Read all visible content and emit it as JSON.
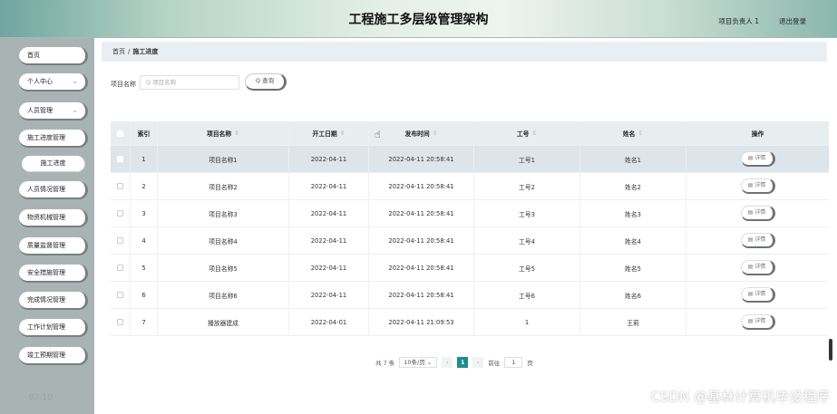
{
  "header": {
    "title": "工程施工多层级管理架构",
    "user": "项目负责人 1",
    "logout": "退出登录"
  },
  "sidebar": {
    "items": [
      {
        "label": "首页"
      },
      {
        "label": "个人中心",
        "chevron": "⌄"
      },
      {
        "label": "人员管理",
        "chevron": "⌄"
      },
      {
        "label": "施工进度管理"
      },
      {
        "label": "施工进度"
      },
      {
        "label": "人员情况管理"
      },
      {
        "label": "物资机械管理"
      },
      {
        "label": "质量监督管理"
      },
      {
        "label": "安全措施管理"
      },
      {
        "label": "完成情况管理"
      },
      {
        "label": "工作计划管理"
      },
      {
        "label": "竣工预期管理"
      }
    ],
    "time": "03:10"
  },
  "breadcrumb": {
    "home": "首页",
    "sep": "/",
    "current": "施工进度"
  },
  "search": {
    "label": "项目名称",
    "placeholder": "Q 项目名称",
    "button": "Q 查询"
  },
  "table": {
    "columns": [
      "索引",
      "项目名称",
      "开工日期",
      "发布时间",
      "工号",
      "姓名",
      "操作"
    ],
    "sort_icon": "⇕",
    "detail_label": "▤ 详情",
    "rows": [
      {
        "index": "1",
        "project": "项目名称1",
        "start": "2022-04-11",
        "publish": "2022-04-11 20:58:41",
        "job_no": "工号1",
        "name": "姓名1"
      },
      {
        "index": "2",
        "project": "项目名称2",
        "start": "2022-04-11",
        "publish": "2022-04-11 20:58:41",
        "job_no": "工号2",
        "name": "姓名2"
      },
      {
        "index": "3",
        "project": "项目名称3",
        "start": "2022-04-11",
        "publish": "2022-04-11 20:58:41",
        "job_no": "工号3",
        "name": "姓名3"
      },
      {
        "index": "4",
        "project": "项目名称4",
        "start": "2022-04-11",
        "publish": "2022-04-11 20:58:41",
        "job_no": "工号4",
        "name": "姓名4"
      },
      {
        "index": "5",
        "project": "项目名称5",
        "start": "2022-04-11",
        "publish": "2022-04-11 20:58:41",
        "job_no": "工号5",
        "name": "姓名5"
      },
      {
        "index": "6",
        "project": "项目名称6",
        "start": "2022-04-11",
        "publish": "2022-04-11 20:58:41",
        "job_no": "工号6",
        "name": "姓名6"
      },
      {
        "index": "7",
        "project": "播放器建成",
        "start": "2022-04-01",
        "publish": "2022-04-11 21:09:53",
        "job_no": "1",
        "name": "王莉"
      }
    ]
  },
  "pager": {
    "total": "共 7 条",
    "page_size": "10条/页 ⌄",
    "prev": "‹",
    "current": "1",
    "next": "›",
    "goto": "前往",
    "goto_value": "1",
    "page_unit": "页"
  },
  "watermark": "CSDN @基林计算机毕设程序",
  "colors": {
    "accent": "#1f8d8e",
    "sidebar": "#a9b3b3",
    "header_row": "#e8edf0"
  }
}
